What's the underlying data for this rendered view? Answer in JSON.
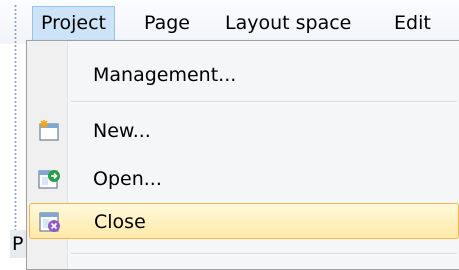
{
  "menubar": {
    "items": [
      {
        "label": "Project",
        "active": true
      },
      {
        "label": "Page",
        "active": false
      },
      {
        "label": "Layout space",
        "active": false
      },
      {
        "label": "Edit",
        "active": false
      }
    ]
  },
  "dropdown": {
    "items": [
      {
        "label": "Management...",
        "icon": null
      },
      {
        "label": "New...",
        "icon": "new-project-icon"
      },
      {
        "label": "Open...",
        "icon": "open-project-icon"
      },
      {
        "label": "Close",
        "icon": "close-project-icon",
        "highlighted": true
      }
    ]
  },
  "background": {
    "partial_text": "P"
  },
  "colors": {
    "menu_active_bg": "#cde3f7",
    "highlight_border": "#f3b74a",
    "highlight_bg": "#ffe9a8"
  }
}
